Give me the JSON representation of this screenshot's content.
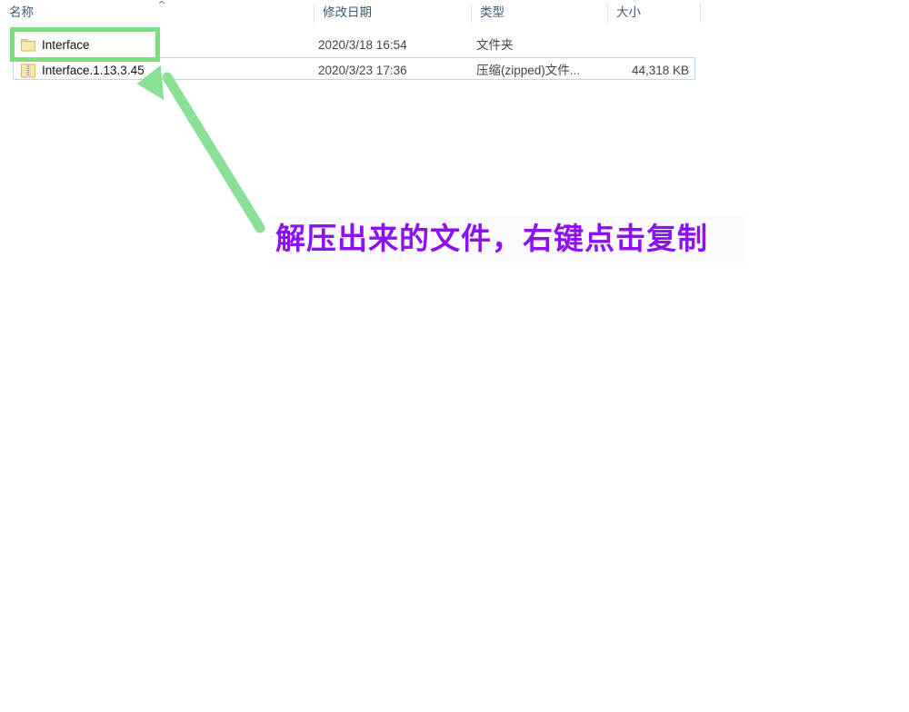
{
  "file_list": {
    "columns": [
      {
        "key": "name",
        "label": "名称"
      },
      {
        "key": "date",
        "label": "修改日期"
      },
      {
        "key": "type",
        "label": "类型"
      },
      {
        "key": "size",
        "label": "大小"
      }
    ],
    "sort_indicator": "^",
    "rows": [
      {
        "icon": "folder-icon",
        "name": "Interface",
        "date": "2020/3/18 16:54",
        "type": "文件夹",
        "size": "",
        "selected": false
      },
      {
        "icon": "zipped-folder-icon",
        "name": "Interface.1.13.3.45",
        "date": "2020/3/23 17:36",
        "type": "压缩(zipped)文件...",
        "size": "44,318 KB",
        "selected": true
      }
    ]
  },
  "annotation": {
    "text": "解压出来的文件，右键点击复制",
    "text_color": "#8c10f0",
    "highlight_color": "#79e07b",
    "arrow_color": "#8ce095"
  }
}
